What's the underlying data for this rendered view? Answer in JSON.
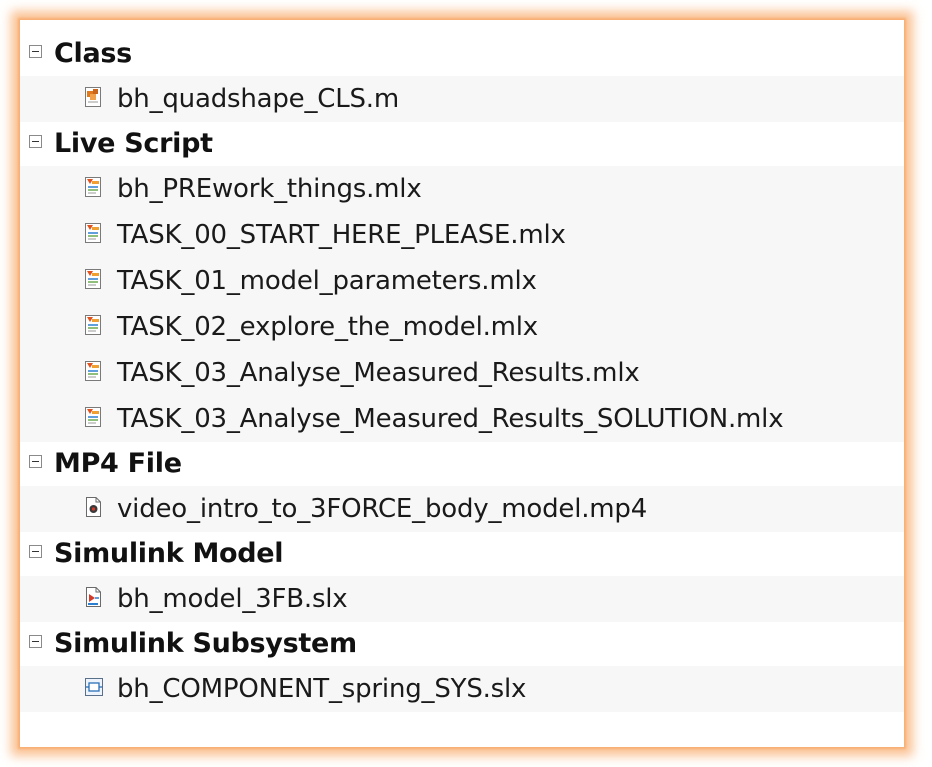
{
  "groups": [
    {
      "title": "Class",
      "items": [
        {
          "name": "bh_quadshape_CLS.m",
          "icon": "class-file-icon"
        }
      ]
    },
    {
      "title": "Live Script",
      "items": [
        {
          "name": "bh_PREwork_things.mlx",
          "icon": "live-script-icon"
        },
        {
          "name": "TASK_00_START_HERE_PLEASE.mlx",
          "icon": "live-script-icon"
        },
        {
          "name": "TASK_01_model_parameters.mlx",
          "icon": "live-script-icon"
        },
        {
          "name": "TASK_02_explore_the_model.mlx",
          "icon": "live-script-icon"
        },
        {
          "name": "TASK_03_Analyse_Measured_Results.mlx",
          "icon": "live-script-icon"
        },
        {
          "name": "TASK_03_Analyse_Measured_Results_SOLUTION.mlx",
          "icon": "live-script-icon"
        }
      ]
    },
    {
      "title": "MP4 File",
      "items": [
        {
          "name": "video_intro_to_3FORCE_body_model.mp4",
          "icon": "video-file-icon"
        }
      ]
    },
    {
      "title": "Simulink Model",
      "items": [
        {
          "name": "bh_model_3FB.slx",
          "icon": "simulink-model-icon"
        }
      ]
    },
    {
      "title": "Simulink Subsystem",
      "items": [
        {
          "name": "bh_COMPONENT_spring_SYS.slx",
          "icon": "simulink-subsystem-icon"
        }
      ]
    }
  ],
  "colors": {
    "frame_glow": "#f8ae70",
    "row_background": "#f7f7f7"
  }
}
